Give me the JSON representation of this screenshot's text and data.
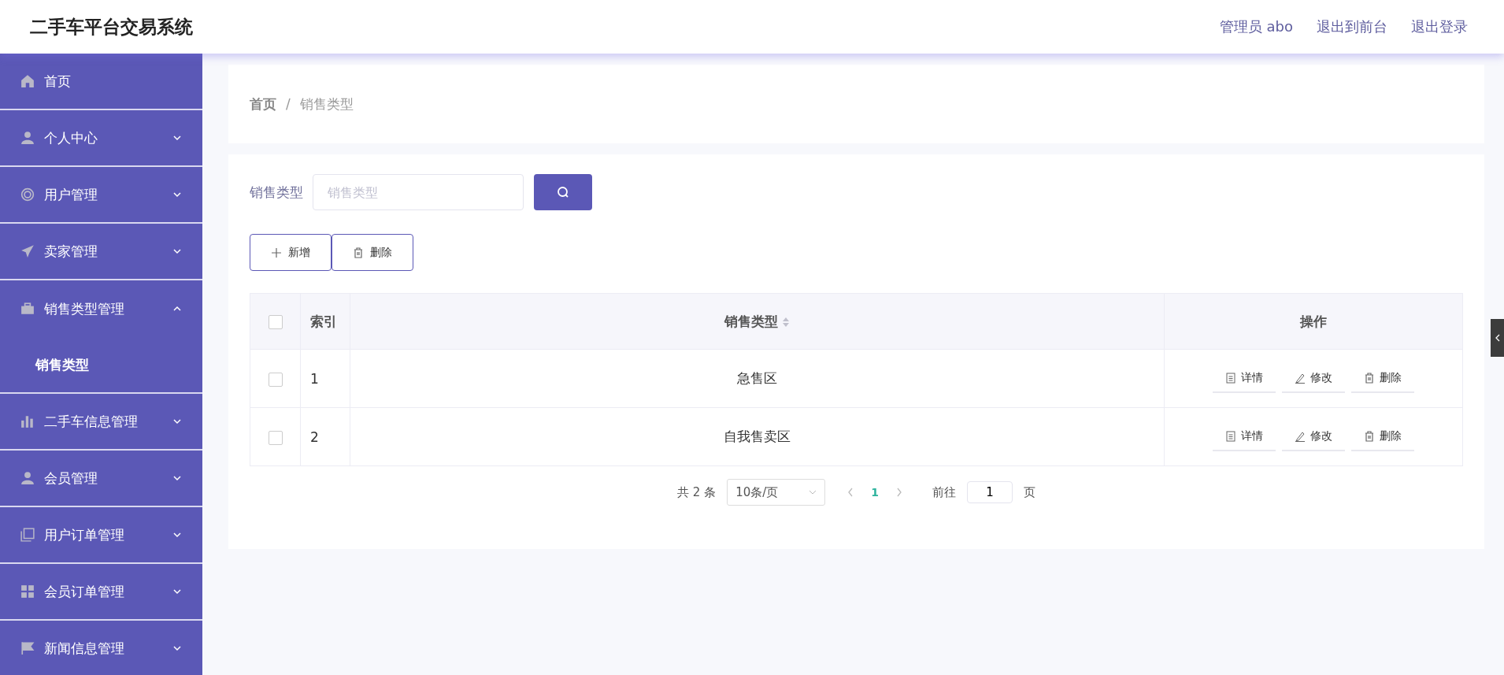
{
  "header": {
    "title": "二手车平台交易系统",
    "links": [
      "管理员 abo",
      "退出到前台",
      "退出登录"
    ]
  },
  "sidebar": {
    "items": [
      {
        "label": "首页"
      },
      {
        "label": "个人中心",
        "expanded": false
      },
      {
        "label": "用户管理",
        "expanded": false
      },
      {
        "label": "卖家管理",
        "expanded": false
      },
      {
        "label": "销售类型管理",
        "expanded": true,
        "children": [
          {
            "label": "销售类型"
          }
        ]
      },
      {
        "label": "二手车信息管理",
        "expanded": false
      },
      {
        "label": "会员管理",
        "expanded": false
      },
      {
        "label": "用户订单管理",
        "expanded": false
      },
      {
        "label": "会员订单管理",
        "expanded": false
      },
      {
        "label": "新闻信息管理",
        "expanded": false
      }
    ]
  },
  "breadcrumb": [
    "首页",
    "/",
    "销售类型"
  ],
  "search": {
    "label": "销售类型",
    "placeholder": "销售类型"
  },
  "actions": [
    "新增",
    "删除"
  ],
  "table": {
    "all_checked": false,
    "columns": [
      "索引",
      "销售类型",
      "操作"
    ],
    "rows": [
      {
        "checked": false,
        "index": "1",
        "type": "急售区",
        "ops": [
          "详情",
          "修改",
          "删除"
        ]
      },
      {
        "checked": false,
        "index": "2",
        "type": "自我售卖区",
        "ops": [
          "详情",
          "修改",
          "删除"
        ]
      }
    ]
  },
  "pagination": {
    "total": "共 2 条",
    "page_size": "10条/页",
    "pages": [
      {
        "label": "1",
        "selected": true
      }
    ],
    "goto": "前往",
    "goto_value": "1",
    "page_unit": "页"
  }
}
